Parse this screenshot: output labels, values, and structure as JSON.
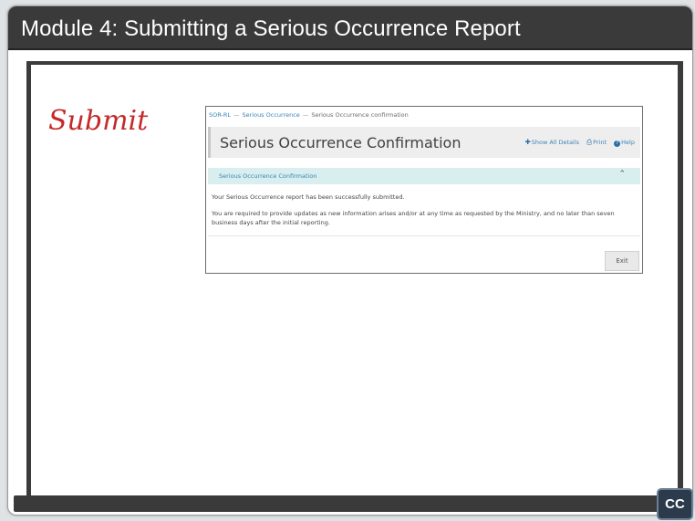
{
  "module": {
    "title": "Module 4:  Submitting a Serious Occurrence Report"
  },
  "slide": {
    "annotation": "Submit"
  },
  "screenshot": {
    "breadcrumb": [
      "SOR-RL",
      "Serious Occurrence",
      "Serious Occurrence confirmation"
    ],
    "heading": "Serious Occurrence Confirmation",
    "toolbar": {
      "show_all": "Show All Details",
      "print": "Print",
      "help": "Help"
    },
    "panel_title": "Serious Occurrence Confirmation",
    "message1": "Your Serious Occurrence report has been successfully submitted.",
    "message2": "You are required to provide updates as new information arises and/or at any time as requested by the Ministry, and no later than seven business days after the initial reporting.",
    "exit_label": "Exit"
  },
  "player": {
    "cc_label": "CC"
  },
  "colors": {
    "title_bar": "#3a3a3a",
    "annotation": "#c42a2a",
    "link": "#3a84b6",
    "panel_header": "#d9eeee"
  },
  "icons": {
    "show_all": "plus-icon",
    "print": "printer-icon",
    "help": "help-icon",
    "collapse": "chevron-up-icon"
  }
}
